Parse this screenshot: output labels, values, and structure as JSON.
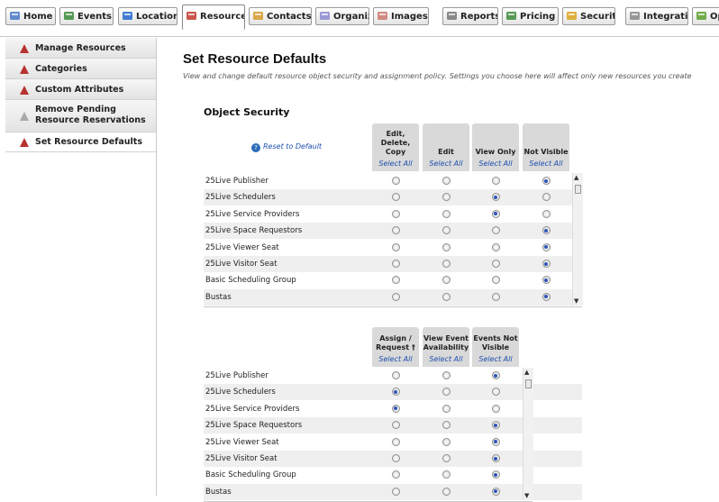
{
  "tabs": [
    {
      "label": "Home",
      "icon": "home-icon",
      "color": "#4a78c8"
    },
    {
      "label": "Events",
      "icon": "events-icon",
      "color": "#3a8a3a"
    },
    {
      "label": "Locations",
      "icon": "locations-icon",
      "color": "#2266cc"
    },
    {
      "label": "Resources",
      "icon": "resources-icon",
      "color": "#c0392b"
    },
    {
      "label": "Contacts",
      "icon": "contacts-icon",
      "color": "#d79a2a"
    },
    {
      "label": "Organizati",
      "icon": "organizations-icon",
      "color": "#8a8ad0"
    },
    {
      "label": "Images",
      "icon": "images-icon",
      "color": "#c9786b"
    },
    {
      "label": "Reports",
      "icon": "reports-icon",
      "color": "#777777"
    },
    {
      "label": "Pricing",
      "icon": "pricing-icon",
      "color": "#3a8a3a"
    },
    {
      "label": "Security",
      "icon": "security-icon",
      "color": "#d9a31c"
    },
    {
      "label": "Integratio",
      "icon": "integrations-icon",
      "color": "#888888"
    },
    {
      "label": "Op",
      "icon": "options-icon",
      "color": "#5aa02c"
    }
  ],
  "active_tab": "Resources",
  "sidebar": {
    "items": [
      {
        "label": "Manage Resources",
        "active": false
      },
      {
        "label": "Categories",
        "active": false
      },
      {
        "label": "Custom Attributes",
        "active": false
      },
      {
        "label": "Remove Pending Resource Reservations",
        "line1": "Remove Pending",
        "line2": "Resource Reservations",
        "active": false
      },
      {
        "label": "Set Resource Defaults",
        "active": true
      }
    ]
  },
  "page": {
    "title": "Set Resource Defaults",
    "description": "View and change default resource object security and assignment policy. Settings you choose here will affect only new resources you create"
  },
  "object_security": {
    "title": "Object Security",
    "reset_label": "Reset to Default",
    "columns": [
      {
        "label": "Edit, Delete, Copy",
        "lines": [
          "Edit,",
          "Delete,",
          "Copy"
        ],
        "select_all": "Select All"
      },
      {
        "label": "Edit",
        "lines": [
          "Edit"
        ],
        "select_all": "Select All"
      },
      {
        "label": "View Only",
        "lines": [
          "View Only"
        ],
        "select_all": "Select All"
      },
      {
        "label": "Not Visible",
        "lines": [
          "Not Visible"
        ],
        "select_all": "Select All"
      }
    ],
    "rows": [
      {
        "name": "25Live Publisher",
        "selected": 3
      },
      {
        "name": "25Live Schedulers",
        "selected": 2
      },
      {
        "name": "25Live Service Providers",
        "selected": 2
      },
      {
        "name": "25Live Space Requestors",
        "selected": 3
      },
      {
        "name": "25Live Viewer Seat",
        "selected": 3
      },
      {
        "name": "25Live Visitor Seat",
        "selected": 3
      },
      {
        "name": "Basic Scheduling Group",
        "selected": 3
      },
      {
        "name": "Bustas",
        "selected": 3
      }
    ]
  },
  "assignment_policy": {
    "columns": [
      {
        "label": "Assign / Request †",
        "lines": [
          "Assign /",
          "Request †"
        ],
        "select_all": "Select All"
      },
      {
        "label": "View Event Availability",
        "lines": [
          "View Event",
          "Availability"
        ],
        "select_all": "Select All"
      },
      {
        "label": "Events Not Visible",
        "lines": [
          "Events Not",
          "Visible"
        ],
        "select_all": "Select All"
      }
    ],
    "rows": [
      {
        "name": "25Live Publisher",
        "selected": 2
      },
      {
        "name": "25Live Schedulers",
        "selected": 0
      },
      {
        "name": "25Live Service Providers",
        "selected": 0
      },
      {
        "name": "25Live Space Requestors",
        "selected": 2
      },
      {
        "name": "25Live Viewer Seat",
        "selected": 2
      },
      {
        "name": "25Live Visitor Seat",
        "selected": 2
      },
      {
        "name": "Basic Scheduling Group",
        "selected": 2
      },
      {
        "name": "Bustas",
        "selected": 2
      }
    ]
  }
}
